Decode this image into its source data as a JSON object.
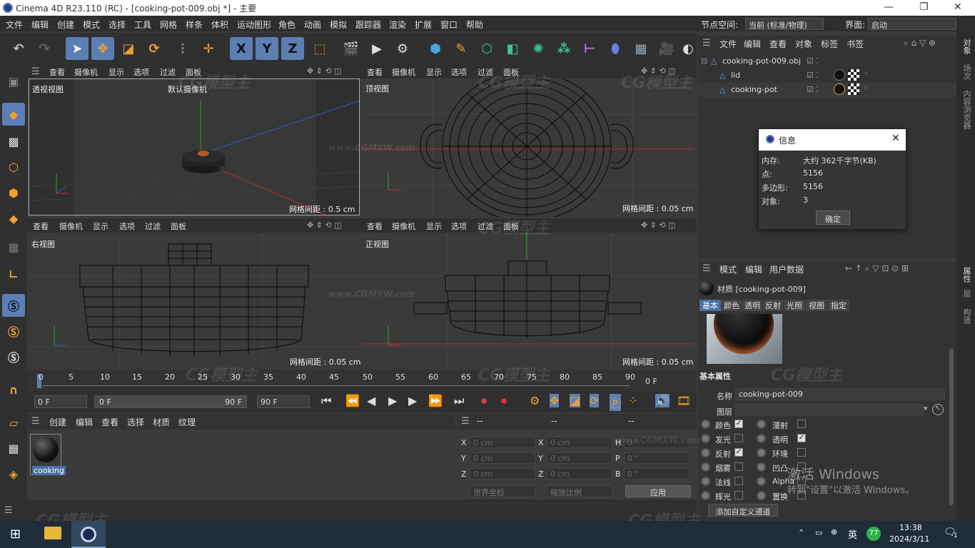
{
  "window": {
    "title": "Cinema 4D R23.110 (RC) - [cooking-pot-009.obj *] - 主要"
  },
  "menu": [
    "文件",
    "编辑",
    "创建",
    "模式",
    "选择",
    "工具",
    "网格",
    "样条",
    "体积",
    "运动图形",
    "角色",
    "动画",
    "模拟",
    "跟踪器",
    "渲染",
    "扩展",
    "窗口",
    "帮助"
  ],
  "node_space": {
    "label": "节点空间:",
    "value": "当前 (标准/物理)"
  },
  "interface": {
    "label": "界面:",
    "value": "启动"
  },
  "toolbar_axes": [
    "X",
    "Y",
    "Z"
  ],
  "viewport_menu": [
    "查看",
    "摄像机",
    "显示",
    "选项",
    "过滤",
    "面板"
  ],
  "viewports": [
    {
      "name": "透视视图",
      "camera": "默认摄像机",
      "grid": "网格间距 : 0.5 cm"
    },
    {
      "name": "顶视图",
      "grid": "网格间距 : 0.05 cm"
    },
    {
      "name": "右视图",
      "grid": "网格间距 : 0.05 cm"
    },
    {
      "name": "正视图",
      "grid": "网格间距 : 0.05 cm"
    }
  ],
  "object_manager": {
    "menu": [
      "文件",
      "编辑",
      "查看",
      "对象",
      "标签",
      "书签"
    ],
    "objects": [
      "cooking-pot-009.obj",
      "lid",
      "cooking-pot"
    ]
  },
  "info_dialog": {
    "title": "信息",
    "rows": [
      {
        "k": "内存:",
        "v": "大约 362千字节(KB)"
      },
      {
        "k": "点:",
        "v": "5156"
      },
      {
        "k": "多边形:",
        "v": "5156"
      },
      {
        "k": "对象:",
        "v": "3"
      }
    ],
    "ok": "确定"
  },
  "right_tabs": [
    "对象",
    "场次",
    "内容浏览器"
  ],
  "right_tabs2": [
    "属性",
    "层",
    "构造"
  ],
  "attr_manager": {
    "menu": [
      "模式",
      "编辑",
      "用户数据"
    ],
    "material_title": "材质 [cooking-pot-009]",
    "tabs": [
      "基本",
      "颜色",
      "透明",
      "反射",
      "光照",
      "视图",
      "指定"
    ],
    "section": "基本属性",
    "name_label": "名称",
    "name_value": "cooking-pot-009",
    "layer_label": "图层",
    "channels_left": [
      {
        "label": "颜色",
        "on": true
      },
      {
        "label": "发光",
        "on": false
      },
      {
        "label": "反射",
        "on": true
      },
      {
        "label": "烟雾",
        "on": false
      },
      {
        "label": "法线",
        "on": false
      },
      {
        "label": "辉光",
        "on": false
      }
    ],
    "channels_right": [
      {
        "label": "漫射",
        "on": false
      },
      {
        "label": "透明",
        "on": true
      },
      {
        "label": "环境",
        "on": false
      },
      {
        "label": "凹凸",
        "on": false
      },
      {
        "label": "Alpha",
        "on": false
      },
      {
        "label": "置换",
        "on": false
      }
    ],
    "add_channel": "添加自定义通道"
  },
  "activation": {
    "line1": "激活 Windows",
    "line2": "转到\"设置\"以激活 Windows。"
  },
  "timeline": {
    "ticks": [
      "0",
      "5",
      "10",
      "15",
      "20",
      "25",
      "30",
      "35",
      "40",
      "45",
      "50",
      "55",
      "60",
      "65",
      "70",
      "75",
      "80",
      "85",
      "90"
    ],
    "end_frame": "0 F",
    "start": "0 F",
    "range_start": "0 F",
    "range_end": "90 F",
    "max": "90 F"
  },
  "material_manager": {
    "menu": [
      "创建",
      "编辑",
      "查看",
      "选择",
      "材质",
      "纹理"
    ],
    "material_name": "cooking"
  },
  "coords": {
    "headers": [
      "--",
      "--",
      "--"
    ],
    "rows": [
      {
        "a": "X",
        "av": "0 cm",
        "b": "X",
        "bv": "0 cm",
        "c": "H",
        "cv": "0 °"
      },
      {
        "a": "Y",
        "av": "0 cm",
        "b": "Y",
        "bv": "0 cm",
        "c": "P",
        "cv": "0 °"
      },
      {
        "a": "Z",
        "av": "0 cm",
        "b": "Z",
        "bv": "0 cm",
        "c": "B",
        "cv": "0 °"
      }
    ],
    "mode1": "世界坐标",
    "mode2": "缩放比例",
    "apply": "应用"
  },
  "watermark": {
    "site": "www.CGMXW.com",
    "brand": "CG模型主"
  },
  "taskbar": {
    "ime": "英",
    "badge": "77",
    "time": "13:38",
    "date": "2024/3/11",
    "notif": "1"
  }
}
